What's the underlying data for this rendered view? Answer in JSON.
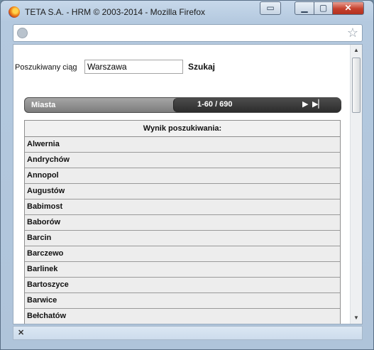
{
  "window": {
    "title": "TETA S.A. - HRM © 2003-2014 - Mozilla Firefox",
    "snap_glyph": "▭",
    "minimize_glyph": "▁",
    "maximize_glyph": "▢",
    "close_glyph": "✕"
  },
  "addressbar": {
    "site_icon": "globe-icon",
    "bookmark_icon": "star-icon",
    "bookmark_glyph": "☆"
  },
  "search": {
    "label": "Poszukiwany ciąg",
    "value": "Warszawa",
    "button": "Szukaj"
  },
  "grid": {
    "title": "Miasta",
    "pager_range": "1-60 / 690",
    "next_glyph": "▶",
    "last_glyph": "▶▏",
    "result_header": "Wynik poszukiwania:",
    "rows": [
      "Alwernia",
      "Andrychów",
      "Annopol",
      "Augustów",
      "Babimost",
      "Baborów",
      "Barcin",
      "Barczewo",
      "Barlinek",
      "Bartoszyce",
      "Barwice",
      "Bełchatów"
    ]
  },
  "statusbar": {
    "close_glyph": "✕"
  }
}
